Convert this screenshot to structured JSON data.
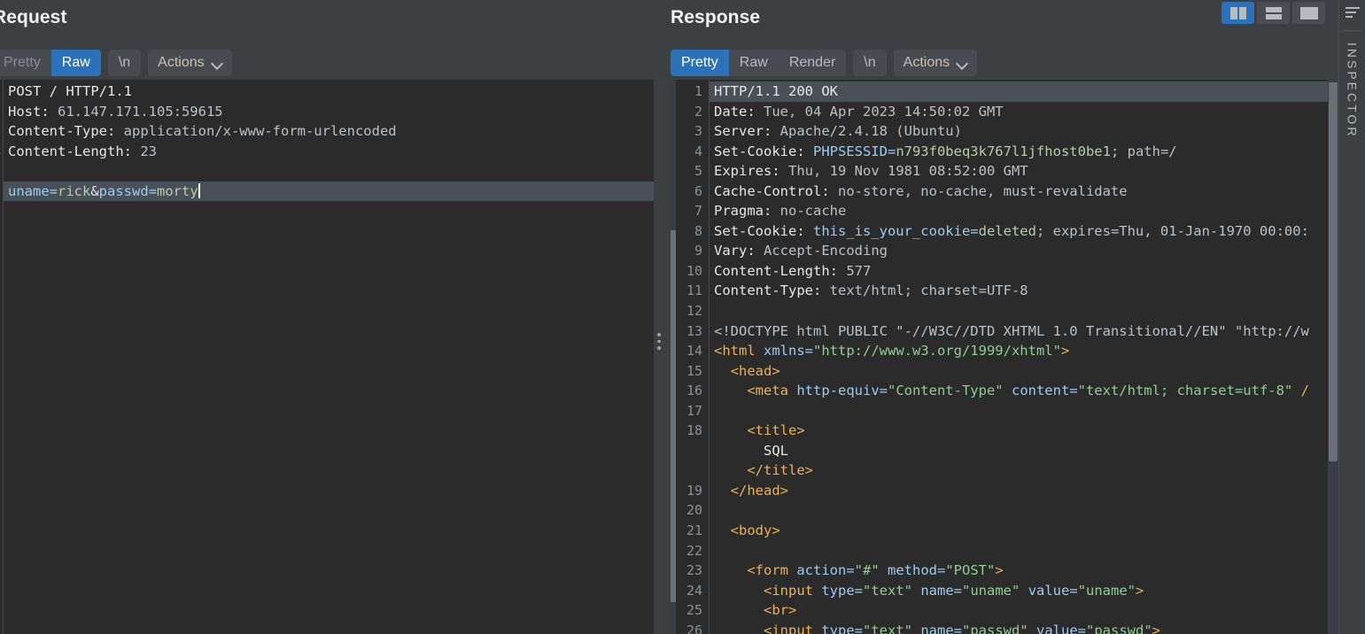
{
  "window": {
    "background_color": "#3c4043",
    "editor_background_color": "#2b2b2b",
    "accent_color": "#2b72b8"
  },
  "layout_buttons": [
    {
      "name": "split-vertical",
      "label": "",
      "active": true
    },
    {
      "name": "split-horizontal",
      "label": "",
      "active": false
    },
    {
      "name": "single-pane",
      "label": "",
      "active": false
    }
  ],
  "inspector": {
    "label": "INSPECTOR",
    "icon": "filter-icon"
  },
  "request": {
    "title": "Request",
    "tabs": [
      {
        "label": "Pretty",
        "active": false
      },
      {
        "label": "Raw",
        "active": true
      }
    ],
    "newline_tab": "\\n",
    "actions_label": "Actions",
    "lines": [
      {
        "n": "1",
        "segments": [
          {
            "t": "POST / HTTP/1.1",
            "c": "t-white"
          }
        ]
      },
      {
        "n": "2",
        "segments": [
          {
            "t": "Host: ",
            "c": "t-white"
          },
          {
            "t": "61.147.171.105:59615",
            "c": "t-grey"
          }
        ]
      },
      {
        "n": "3",
        "segments": [
          {
            "t": "Content-Type: ",
            "c": "t-white"
          },
          {
            "t": "application/x-www-form-urlencoded",
            "c": "t-grey"
          }
        ]
      },
      {
        "n": "4",
        "segments": [
          {
            "t": "Content-Length: ",
            "c": "t-white"
          },
          {
            "t": "23",
            "c": "t-grey"
          }
        ]
      },
      {
        "n": "5",
        "segments": [
          {
            "t": "",
            "c": "t-plain"
          }
        ]
      },
      {
        "n": "6",
        "highlight": true,
        "caret": true,
        "segments": [
          {
            "t": "uname=",
            "c": "t-key"
          },
          {
            "t": "rick",
            "c": "t-val"
          },
          {
            "t": "&",
            "c": "t-white"
          },
          {
            "t": "passwd=",
            "c": "t-key"
          },
          {
            "t": "morty",
            "c": "t-val"
          }
        ]
      }
    ]
  },
  "response": {
    "title": "Response",
    "tabs": [
      {
        "label": "Pretty",
        "active": true
      },
      {
        "label": "Raw",
        "active": false
      },
      {
        "label": "Render",
        "active": false
      }
    ],
    "newline_tab": "\\n",
    "actions_label": "Actions",
    "lines": [
      {
        "n": "1",
        "highlight": true,
        "segments": [
          {
            "t": "HTTP/1.1 200 OK",
            "c": "t-white"
          }
        ]
      },
      {
        "n": "2",
        "segments": [
          {
            "t": "Date: ",
            "c": "t-white"
          },
          {
            "t": "Tue, 04 Apr 2023 14:50:02 GMT",
            "c": "t-grey"
          }
        ]
      },
      {
        "n": "3",
        "segments": [
          {
            "t": "Server: ",
            "c": "t-white"
          },
          {
            "t": "Apache/2.4.18 (Ubuntu)",
            "c": "t-grey"
          }
        ]
      },
      {
        "n": "4",
        "segments": [
          {
            "t": "Set-Cookie: ",
            "c": "t-white"
          },
          {
            "t": "PHPSESSID=",
            "c": "t-key"
          },
          {
            "t": "n793f0beq3k767l1jfhost0be1",
            "c": "t-val"
          },
          {
            "t": "; path=/",
            "c": "t-grey"
          }
        ]
      },
      {
        "n": "5",
        "segments": [
          {
            "t": "Expires: ",
            "c": "t-white"
          },
          {
            "t": "Thu, 19 Nov 1981 08:52:00 GMT",
            "c": "t-grey"
          }
        ]
      },
      {
        "n": "6",
        "segments": [
          {
            "t": "Cache-Control: ",
            "c": "t-white"
          },
          {
            "t": "no-store, no-cache, must-revalidate",
            "c": "t-grey"
          }
        ]
      },
      {
        "n": "7",
        "segments": [
          {
            "t": "Pragma: ",
            "c": "t-white"
          },
          {
            "t": "no-cache",
            "c": "t-grey"
          }
        ]
      },
      {
        "n": "8",
        "segments": [
          {
            "t": "Set-Cookie: ",
            "c": "t-white"
          },
          {
            "t": "this_is_your_cookie=",
            "c": "t-key"
          },
          {
            "t": "deleted",
            "c": "t-val"
          },
          {
            "t": "; expires=Thu, 01-Jan-1970 00:00:",
            "c": "t-grey"
          }
        ]
      },
      {
        "n": "9",
        "segments": [
          {
            "t": "Vary: ",
            "c": "t-white"
          },
          {
            "t": "Accept-Encoding",
            "c": "t-grey"
          }
        ]
      },
      {
        "n": "10",
        "segments": [
          {
            "t": "Content-Length: ",
            "c": "t-white"
          },
          {
            "t": "577",
            "c": "t-grey"
          }
        ]
      },
      {
        "n": "11",
        "segments": [
          {
            "t": "Content-Type: ",
            "c": "t-white"
          },
          {
            "t": "text/html; charset=UTF-8",
            "c": "t-grey"
          }
        ]
      },
      {
        "n": "12",
        "segments": [
          {
            "t": "",
            "c": "t-plain"
          }
        ]
      },
      {
        "n": "13",
        "segments": [
          {
            "t": "<!DOCTYPE html PUBLIC \"-//W3C//DTD XHTML 1.0 Transitional//EN\" \"http://w",
            "c": "t-grey"
          }
        ]
      },
      {
        "n": "14",
        "segments": [
          {
            "t": "<html ",
            "c": "t-tag"
          },
          {
            "t": "xmlns=",
            "c": "t-attr"
          },
          {
            "t": "\"http://www.w3.org/1999/xhtml\"",
            "c": "t-str"
          },
          {
            "t": ">",
            "c": "t-tag"
          }
        ]
      },
      {
        "n": "15",
        "segments": [
          {
            "t": "  <head>",
            "c": "t-tag"
          }
        ]
      },
      {
        "n": "16",
        "segments": [
          {
            "t": "    <meta ",
            "c": "t-tag"
          },
          {
            "t": "http-equiv=",
            "c": "t-attr"
          },
          {
            "t": "\"Content-Type\"",
            "c": "t-str"
          },
          {
            "t": " ",
            "c": "t-plain"
          },
          {
            "t": "content=",
            "c": "t-attr"
          },
          {
            "t": "\"text/html; charset=utf-8\"",
            "c": "t-str"
          },
          {
            "t": " /",
            "c": "t-tag"
          }
        ]
      },
      {
        "n": "17",
        "segments": [
          {
            "t": "",
            "c": "t-plain"
          }
        ]
      },
      {
        "n": "18",
        "segments": [
          {
            "t": "    <title>",
            "c": "t-tag"
          }
        ]
      },
      {
        "n": "",
        "segments": [
          {
            "t": "      SQL",
            "c": "t-white"
          }
        ]
      },
      {
        "n": "",
        "segments": [
          {
            "t": "    </title>",
            "c": "t-tag"
          }
        ]
      },
      {
        "n": "19",
        "segments": [
          {
            "t": "  </head>",
            "c": "t-tag"
          }
        ]
      },
      {
        "n": "20",
        "segments": [
          {
            "t": "",
            "c": "t-plain"
          }
        ]
      },
      {
        "n": "21",
        "segments": [
          {
            "t": "  <body>",
            "c": "t-tag"
          }
        ]
      },
      {
        "n": "22",
        "segments": [
          {
            "t": "",
            "c": "t-plain"
          }
        ]
      },
      {
        "n": "23",
        "segments": [
          {
            "t": "    <form ",
            "c": "t-tag"
          },
          {
            "t": "action=",
            "c": "t-attr"
          },
          {
            "t": "\"#\"",
            "c": "t-str"
          },
          {
            "t": " ",
            "c": "t-plain"
          },
          {
            "t": "method=",
            "c": "t-attr"
          },
          {
            "t": "\"POST\"",
            "c": "t-str"
          },
          {
            "t": ">",
            "c": "t-tag"
          }
        ]
      },
      {
        "n": "24",
        "segments": [
          {
            "t": "      <input ",
            "c": "t-tag"
          },
          {
            "t": "type=",
            "c": "t-attr"
          },
          {
            "t": "\"text\"",
            "c": "t-str"
          },
          {
            "t": " ",
            "c": "t-plain"
          },
          {
            "t": "name=",
            "c": "t-attr"
          },
          {
            "t": "\"uname\"",
            "c": "t-str"
          },
          {
            "t": " ",
            "c": "t-plain"
          },
          {
            "t": "value=",
            "c": "t-attr"
          },
          {
            "t": "\"uname\"",
            "c": "t-str"
          },
          {
            "t": ">",
            "c": "t-tag"
          }
        ]
      },
      {
        "n": "25",
        "segments": [
          {
            "t": "      <br>",
            "c": "t-tag"
          }
        ]
      },
      {
        "n": "26",
        "segments": [
          {
            "t": "      <input ",
            "c": "t-tag"
          },
          {
            "t": "type=",
            "c": "t-attr"
          },
          {
            "t": "\"text\"",
            "c": "t-str"
          },
          {
            "t": " ",
            "c": "t-plain"
          },
          {
            "t": "name=",
            "c": "t-attr"
          },
          {
            "t": "\"passwd\"",
            "c": "t-str"
          },
          {
            "t": " ",
            "c": "t-plain"
          },
          {
            "t": "value=",
            "c": "t-attr"
          },
          {
            "t": "\"passwd\"",
            "c": "t-str"
          },
          {
            "t": ">",
            "c": "t-tag"
          }
        ]
      }
    ]
  }
}
